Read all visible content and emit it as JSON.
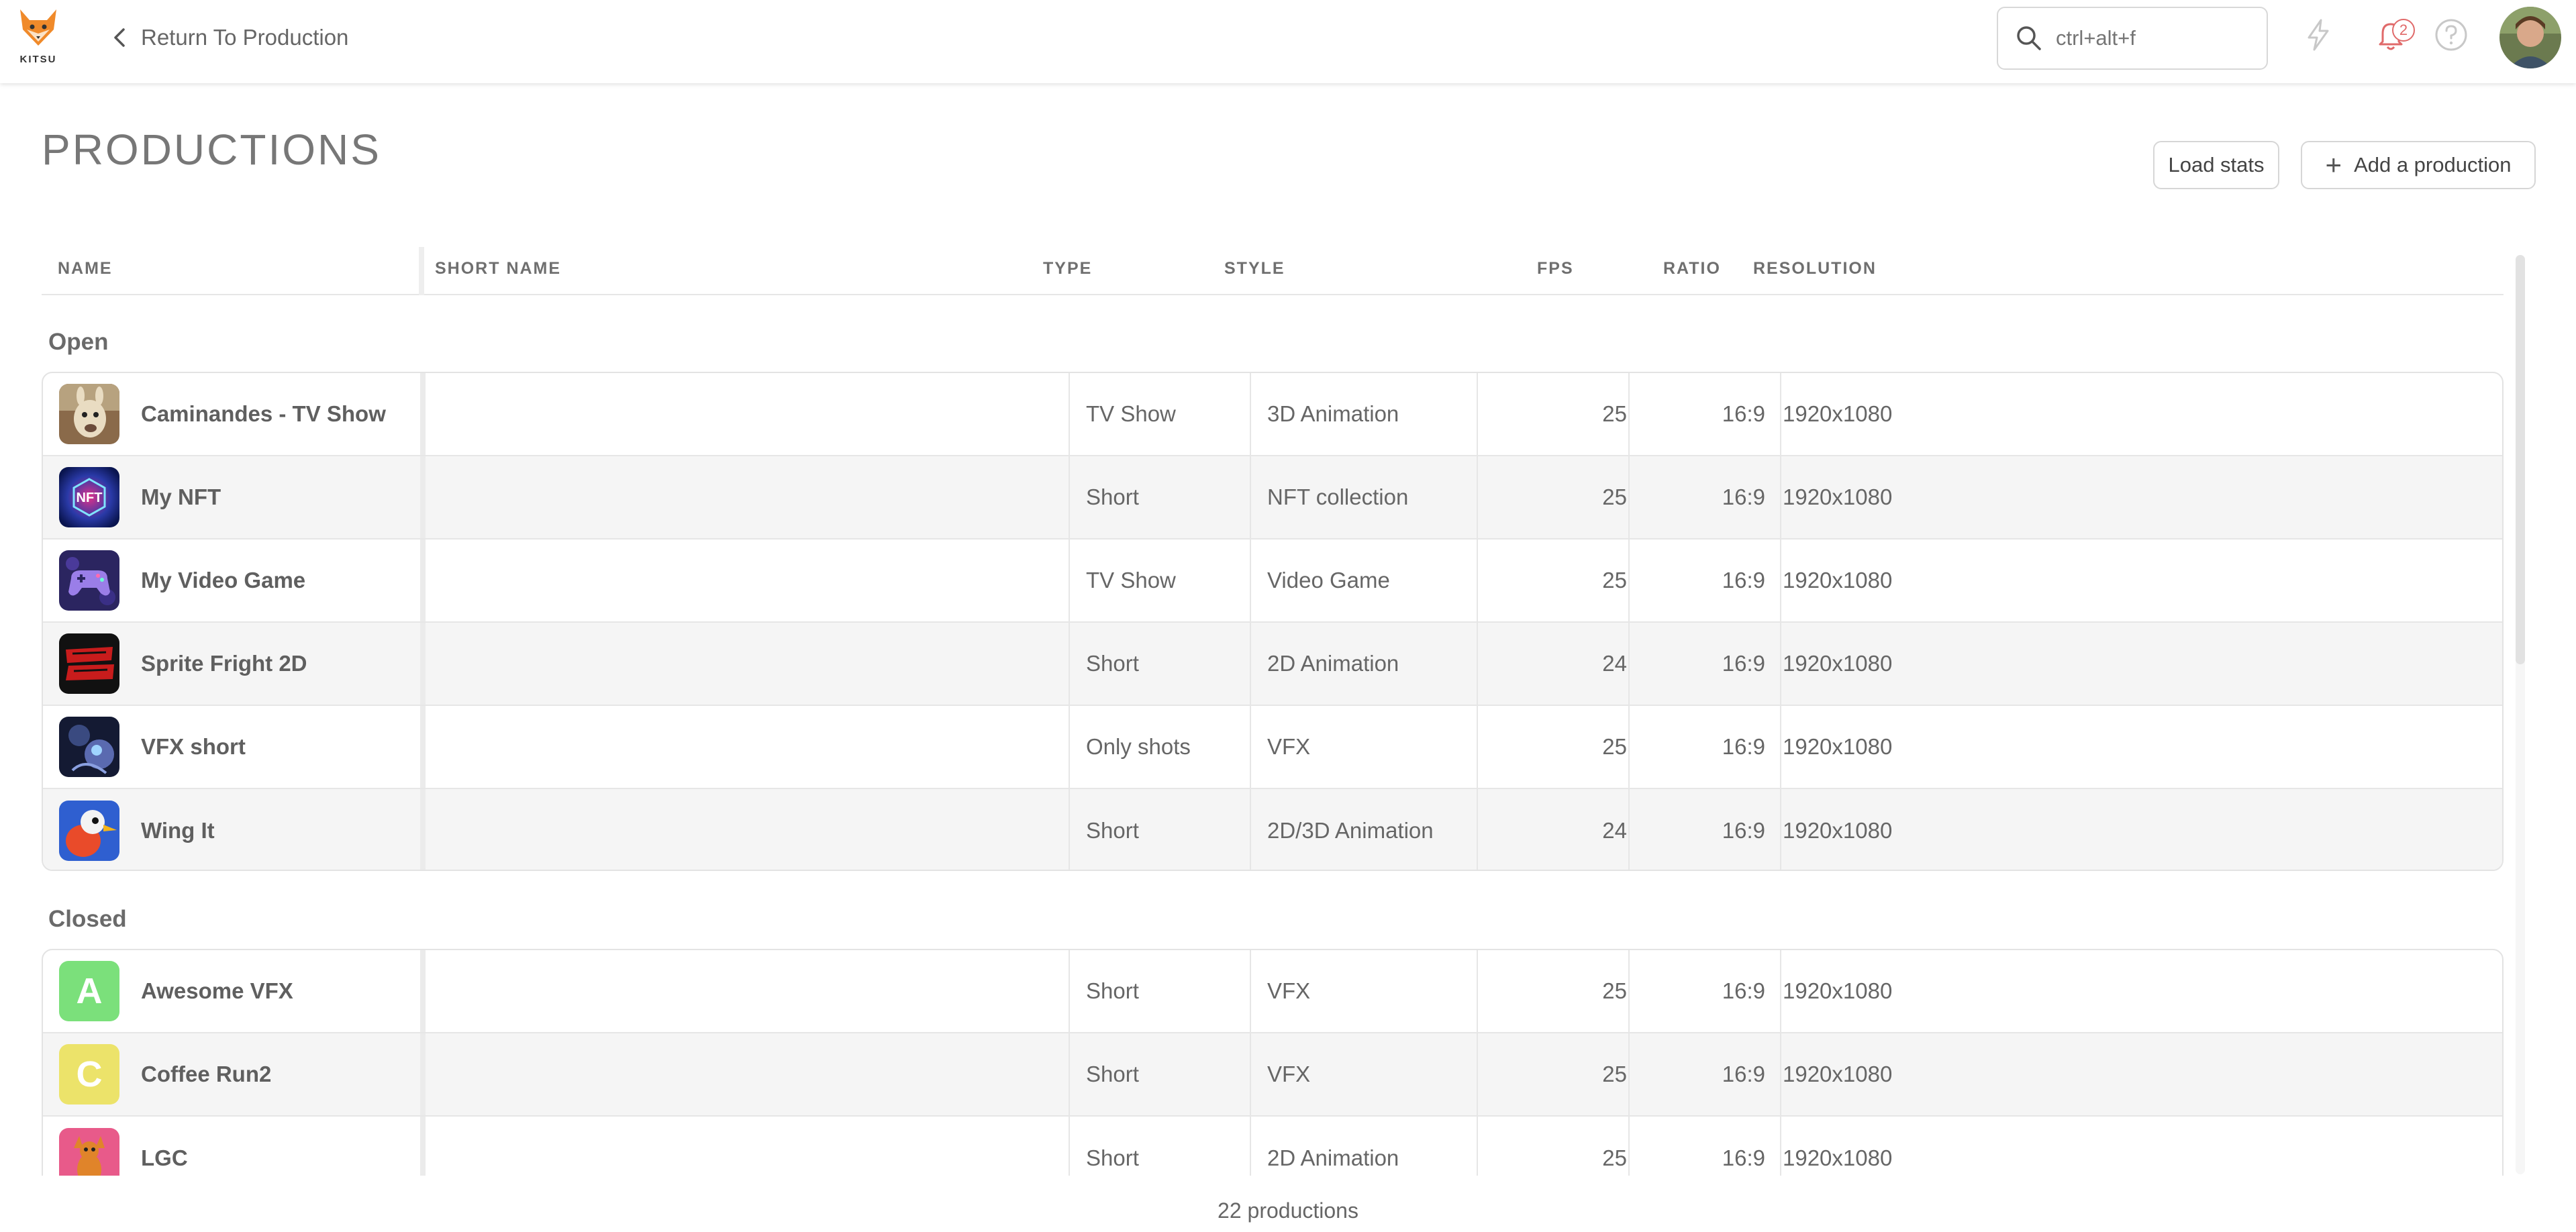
{
  "app": {
    "logo_text": "KITSU"
  },
  "nav": {
    "back_label": "Return To Production"
  },
  "search": {
    "placeholder": "ctrl+alt+f"
  },
  "notifications": {
    "count": "2"
  },
  "page": {
    "title": "PRODUCTIONS",
    "load_stats_label": "Load stats",
    "add_production_label": "Add a production"
  },
  "table": {
    "columns": {
      "name": "NAME",
      "short_name": "SHORT NAME",
      "type": "TYPE",
      "style": "STYLE",
      "fps": "FPS",
      "ratio": "RATIO",
      "resolution": "RESOLUTION"
    },
    "groups": {
      "open": {
        "label": "Open",
        "rows": [
          {
            "name": "Caminandes - TV Show",
            "short_name": "",
            "type": "TV Show",
            "style": "3D Animation",
            "fps": "25",
            "ratio": "16:9",
            "resolution": "1920x1080",
            "thumb": "llama-icon"
          },
          {
            "name": "My NFT",
            "short_name": "",
            "type": "Short",
            "style": "NFT collection",
            "fps": "25",
            "ratio": "16:9",
            "resolution": "1920x1080",
            "thumb": "nft-icon"
          },
          {
            "name": "My Video Game",
            "short_name": "",
            "type": "TV Show",
            "style": "Video Game",
            "fps": "25",
            "ratio": "16:9",
            "resolution": "1920x1080",
            "thumb": "gamepad-icon"
          },
          {
            "name": "Sprite Fright 2D",
            "short_name": "",
            "type": "Short",
            "style": "2D Animation",
            "fps": "24",
            "ratio": "16:9",
            "resolution": "1920x1080",
            "thumb": "sprite-fright-icon"
          },
          {
            "name": "VFX short",
            "short_name": "",
            "type": "Only shots",
            "style": "VFX",
            "fps": "25",
            "ratio": "16:9",
            "resolution": "1920x1080",
            "thumb": "vfx-robot-icon"
          },
          {
            "name": "Wing It",
            "short_name": "",
            "type": "Short",
            "style": "2D/3D Animation",
            "fps": "24",
            "ratio": "16:9",
            "resolution": "1920x1080",
            "thumb": "bird-icon"
          }
        ]
      },
      "closed": {
        "label": "Closed",
        "rows": [
          {
            "name": "Awesome VFX",
            "short_name": "",
            "type": "Short",
            "style": "VFX",
            "fps": "25",
            "ratio": "16:9",
            "resolution": "1920x1080",
            "letter": "A",
            "color": "#7be07b"
          },
          {
            "name": "Coffee Run2",
            "short_name": "",
            "type": "Short",
            "style": "VFX",
            "fps": "25",
            "ratio": "16:9",
            "resolution": "1920x1080",
            "letter": "C",
            "color": "#ece36a"
          },
          {
            "name": "LGC",
            "short_name": "",
            "type": "Short",
            "style": "2D Animation",
            "fps": "25",
            "ratio": "16:9",
            "resolution": "1920x1080",
            "thumb": "lgc-character-icon"
          }
        ]
      }
    }
  },
  "footer": {
    "count_label": "22 productions"
  },
  "colors": {
    "accent": "#e06a6a",
    "brand_orange": "#f08a2a",
    "alt_row": "#f5f5f5"
  }
}
